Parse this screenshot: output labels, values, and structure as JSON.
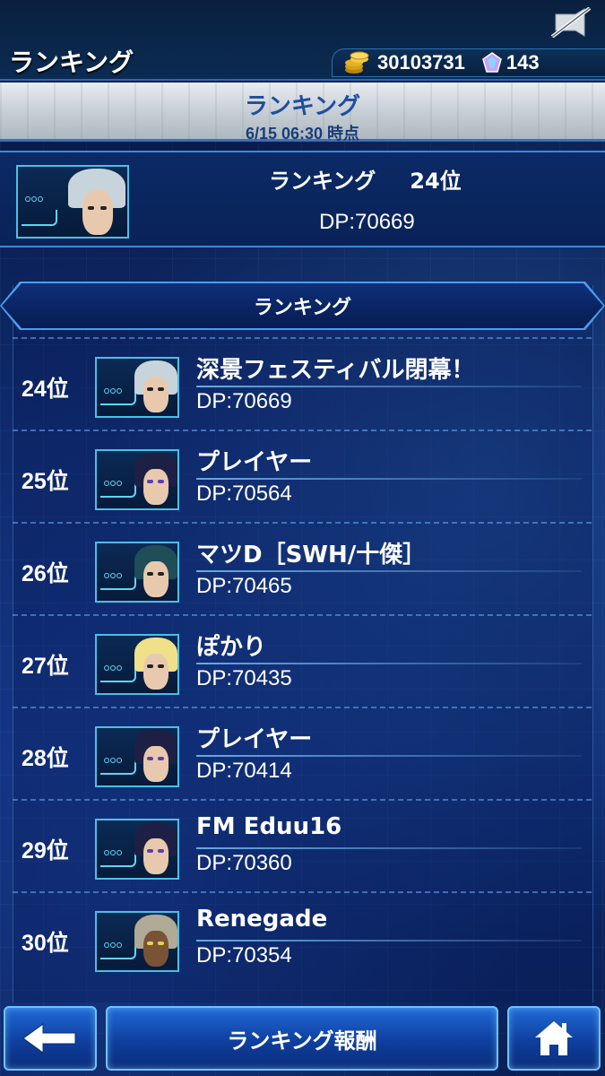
{
  "header": {
    "title": "ランキング",
    "gold": "30103731",
    "gems": "143",
    "icons": {
      "mute": "sound-off-icon",
      "gold": "gold-coin-icon",
      "gem": "gem-icon"
    }
  },
  "banner": {
    "title": "ランキング",
    "subtitle": "6/15 06:30 時点"
  },
  "my_ranking": {
    "label": "ランキング",
    "rank": "24位",
    "dp": "DP:70669"
  },
  "list": {
    "title": "ランキング",
    "rows": [
      {
        "rank": "24位",
        "name": "深景フェスティバル閉幕！",
        "dp": "DP:70669",
        "avatar": "white-hair"
      },
      {
        "rank": "25位",
        "name": "プレイヤー",
        "dp": "DP:70564",
        "avatar": "dark-hair"
      },
      {
        "rank": "26位",
        "name": "マツD［SWH/十傑］",
        "dp": "DP:70465",
        "avatar": "teal-hair"
      },
      {
        "rank": "27位",
        "name": "ぽかり",
        "dp": "DP:70435",
        "avatar": "blonde-hair"
      },
      {
        "rank": "28位",
        "name": "プレイヤー",
        "dp": "DP:70414",
        "avatar": "dark-hair"
      },
      {
        "rank": "29位",
        "name": "FM Eduu16",
        "dp": "DP:70360",
        "avatar": "dark-hair"
      },
      {
        "rank": "30位",
        "name": "Renegade",
        "dp": "DP:70354",
        "avatar": "gray-hair"
      }
    ]
  },
  "footer": {
    "reward_label": "ランキング報酬",
    "icons": {
      "back": "back-arrow-icon",
      "home": "home-icon"
    }
  },
  "colors": {
    "accent": "#4a9ef0",
    "banner_text": "#1d4fa0",
    "background": "#0c2460"
  }
}
